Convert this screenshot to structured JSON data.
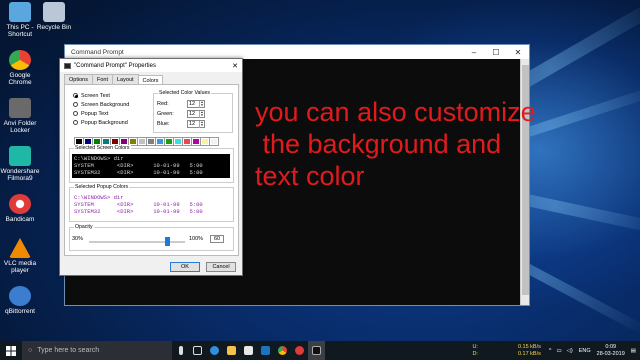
{
  "desktop_icons": [
    {
      "name": "this-pc",
      "label": "This PC - Shortcut",
      "color": "#5aa7e0"
    },
    {
      "name": "recycle-bin",
      "label": "Recycle Bin",
      "color": "#b9c7d6"
    },
    {
      "name": "google-chrome",
      "label": "Google Chrome",
      "color": "#e94235"
    },
    {
      "name": "anvi-folder-locker",
      "label": "Anvi Folder Locker",
      "color": "#6a6a6a"
    },
    {
      "name": "wondershare-filmora",
      "label": "Wondershare Filmora9",
      "color": "#1fb7a6"
    },
    {
      "name": "bandicam",
      "label": "Bandicam",
      "color": "#e03a3a"
    },
    {
      "name": "vlc",
      "label": "VLC media player",
      "color": "#f08a00"
    },
    {
      "name": "qbittorrent",
      "label": "qBittorrent",
      "color": "#3b7ed0"
    }
  ],
  "cmd_window": {
    "title": "Command Prompt"
  },
  "dialog": {
    "title": "\"Command Prompt\" Properties",
    "tabs": [
      "Options",
      "Font",
      "Layout",
      "Colors"
    ],
    "active_tab": "Colors",
    "radios": [
      "Screen Text",
      "Screen Background",
      "Popup Text",
      "Popup Background"
    ],
    "selected_values_label": "Selected Color Values",
    "red_label": "Red:",
    "green_label": "Green:",
    "blue_label": "Blue:",
    "red": "12",
    "green": "12",
    "blue": "12",
    "palette": [
      "#000000",
      "#000080",
      "#008000",
      "#008080",
      "#800000",
      "#800080",
      "#808000",
      "#c0c0c0",
      "#808080",
      "#3a96dd",
      "#13a10e",
      "#3ae0dd",
      "#e74856",
      "#b4009e",
      "#f9f1a5",
      "#f2f2f2"
    ],
    "screen_colors_label": "Selected Screen Colors",
    "screen_preview": [
      "C:\\WINDOWS> dir",
      "SYSTEM       <DIR>      10-01-99   5:00",
      "SYSTEM32     <DIR>      10-01-99   5:00"
    ],
    "popup_colors_label": "Selected Popup Colors",
    "popup_preview": [
      "C:\\WINDOWS> dir",
      "SYSTEM       <DIR>      10-01-99   5:00",
      "SYSTEM32     <DIR>      10-01-99   5:00"
    ],
    "opacity_label": "Opacity",
    "opacity_min": "30%",
    "opacity_max": "100%",
    "opacity_value": "60",
    "ok_label": "OK",
    "cancel_label": "Cancel"
  },
  "overlay_text": [
    "you can also customize",
    " the background and",
    "text color"
  ],
  "taskbar": {
    "search_placeholder": "Type here to search",
    "net_up_label": "U:",
    "net_up": "0.15 kB/s",
    "net_down_label": "D:",
    "net_down": "0.17 kB/s",
    "lang": "ENG",
    "time": "0:09",
    "date": "28-03-2019"
  }
}
